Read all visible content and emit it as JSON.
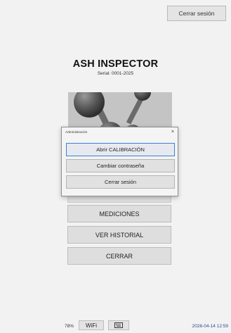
{
  "header": {
    "logout_label": "Cerrar sesión"
  },
  "app": {
    "title": "ASH INSPECTOR",
    "serial": "Serial: 0001-2025"
  },
  "menu": {
    "measurements_label": "MEDICIONES",
    "history_label": "VER HISTORIAL",
    "close_label": "CERRAR"
  },
  "dialog": {
    "title": "Administración",
    "close_glyph": "×",
    "calibration_label": "Abrir CALIBRACIÓN",
    "change_password_label": "Cambiar contraseña",
    "logout_label": "Cerrar sesión"
  },
  "status": {
    "battery": "78%",
    "wifi_label": "WiFi",
    "keyboard_icon": "keyboard-icon",
    "datetime": "2026-04-14 12:59"
  },
  "colors": {
    "background": "#f2f2f2",
    "button": "#dedede",
    "logo_bg": "#c4c4c4",
    "focus": "#3c7fd6",
    "datetime": "#2b4a9e"
  }
}
